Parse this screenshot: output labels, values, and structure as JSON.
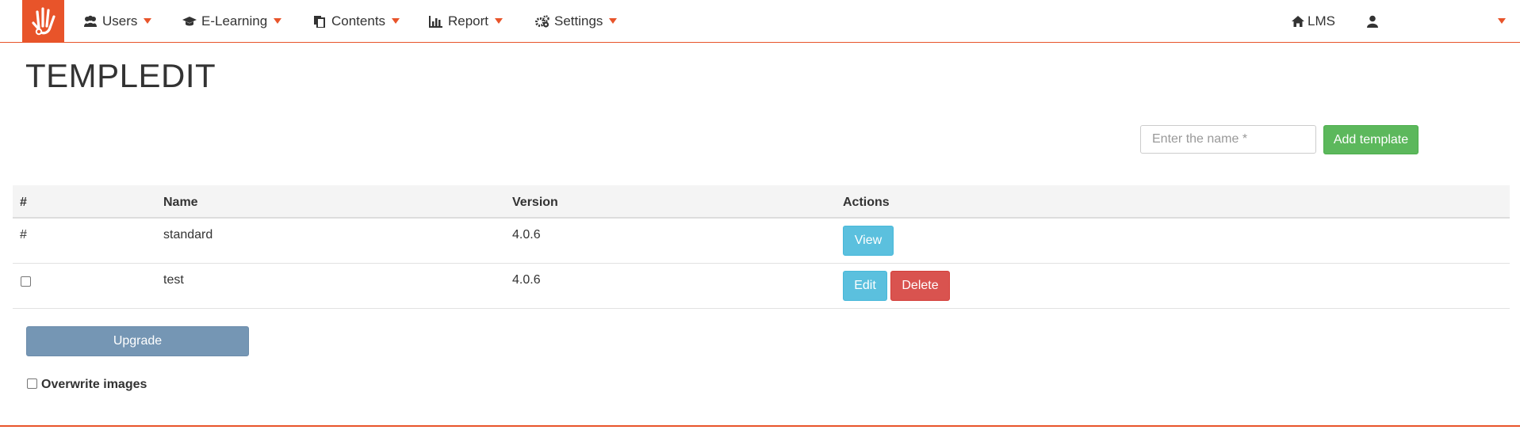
{
  "nav": {
    "items": [
      {
        "label": "Users",
        "icon": "users-icon"
      },
      {
        "label": "E-Learning",
        "icon": "graduation-cap-icon"
      },
      {
        "label": "Contents",
        "icon": "files-icon"
      },
      {
        "label": "Report",
        "icon": "bar-chart-icon"
      },
      {
        "label": "Settings",
        "icon": "gears-icon"
      }
    ],
    "lms_label": "LMS"
  },
  "page": {
    "title": "TEMPLEDIT"
  },
  "add_form": {
    "placeholder": "Enter the name *",
    "value": "",
    "add_label": "Add template"
  },
  "table": {
    "headers": [
      "#",
      "Name",
      "Version",
      "Actions"
    ],
    "rows": [
      {
        "marker": "#",
        "name": "standard",
        "version": "4.0.6",
        "actions": [
          "View"
        ]
      },
      {
        "marker": "",
        "name": "test",
        "version": "4.0.6",
        "actions": [
          "Edit",
          "Delete"
        ]
      }
    ]
  },
  "upgrade_label": "Upgrade",
  "overwrite_label": "Overwrite images",
  "colors": {
    "accent": "#e8542a",
    "success": "#5cb85c",
    "info": "#5bc0de",
    "danger": "#d9534f",
    "upgrade": "#7596b4"
  }
}
